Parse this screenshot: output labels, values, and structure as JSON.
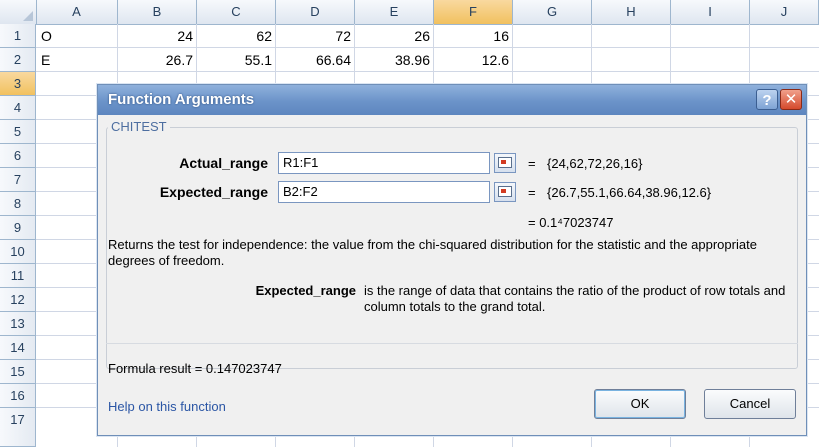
{
  "spreadsheet": {
    "columns": [
      "A",
      "B",
      "C",
      "D",
      "E",
      "F",
      "G",
      "H",
      "I",
      "J"
    ],
    "selected_column": "F",
    "rows": [
      "1",
      "2",
      "3",
      "4",
      "5",
      "6",
      "7",
      "8",
      "9",
      "10",
      "11",
      "12",
      "13",
      "14",
      "15",
      "16",
      "17"
    ],
    "selected_row": "3",
    "row1": {
      "A": "O",
      "B": "24",
      "C": "62",
      "D": "72",
      "E": "26",
      "F": "16"
    },
    "row2": {
      "A": "E",
      "B": "26.7",
      "C": "55.1",
      "D": "66.64",
      "E": "38.96",
      "F": "12.6"
    }
  },
  "dialog": {
    "title": "Function Arguments",
    "help_glyph": "?",
    "close_glyph": "✕",
    "function_name": "CHITEST",
    "args": [
      {
        "label": "Actual_range",
        "value": "R1:F1",
        "eq": "=",
        "evaluated": "{24,62,72,26,16}"
      },
      {
        "label": "Expected_range",
        "value": "B2:F2",
        "eq": "=",
        "evaluated": "{26.7,55.1,66.64,38.96,12.6}"
      }
    ],
    "function_result": "= 0.1⁴7023747",
    "description": "Returns the test for independence: the value from the chi-squared distribution for the statistic and the appropriate degrees of freedom.",
    "param_name": "Expected_range",
    "param_description": "is the range of data that contains the ratio of the product of row totals and column totals to the grand total.",
    "formula_result": "Formula result =  0.147023747",
    "help_link": "Help on this function",
    "ok_label": "OK",
    "cancel_label": "Cancel"
  },
  "colors": {
    "title_bar": "#6b93c9",
    "selected_header": "#f1c15f",
    "link": "#2b56a5"
  }
}
